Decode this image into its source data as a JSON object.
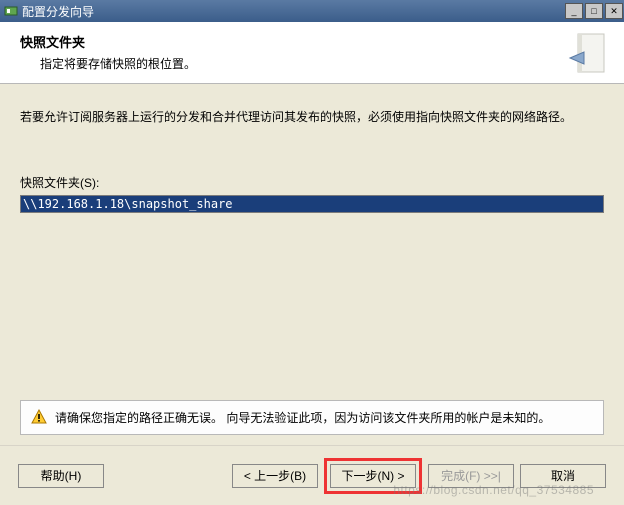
{
  "titlebar": {
    "title": "配置分发向导"
  },
  "header": {
    "title": "快照文件夹",
    "subtitle": "指定将要存储快照的根位置。"
  },
  "content": {
    "description": "若要允许订阅服务器上运行的分发和合并代理访问其发布的快照，必须使用指向快照文件夹的网络路径。",
    "folder_label": "快照文件夹(S):",
    "folder_value": "\\\\192.168.1.18\\snapshot_share"
  },
  "warning": {
    "text": "请确保您指定的路径正确无误。 向导无法验证此项，因为访问该文件夹所用的帐户是未知的。"
  },
  "footer": {
    "help": "帮助(H)",
    "back": "< 上一步(B)",
    "next": "下一步(N) >",
    "finish": "完成(F) >>|",
    "cancel": "取消"
  },
  "watermark": "https://blog.csdn.net/qq_37534885"
}
